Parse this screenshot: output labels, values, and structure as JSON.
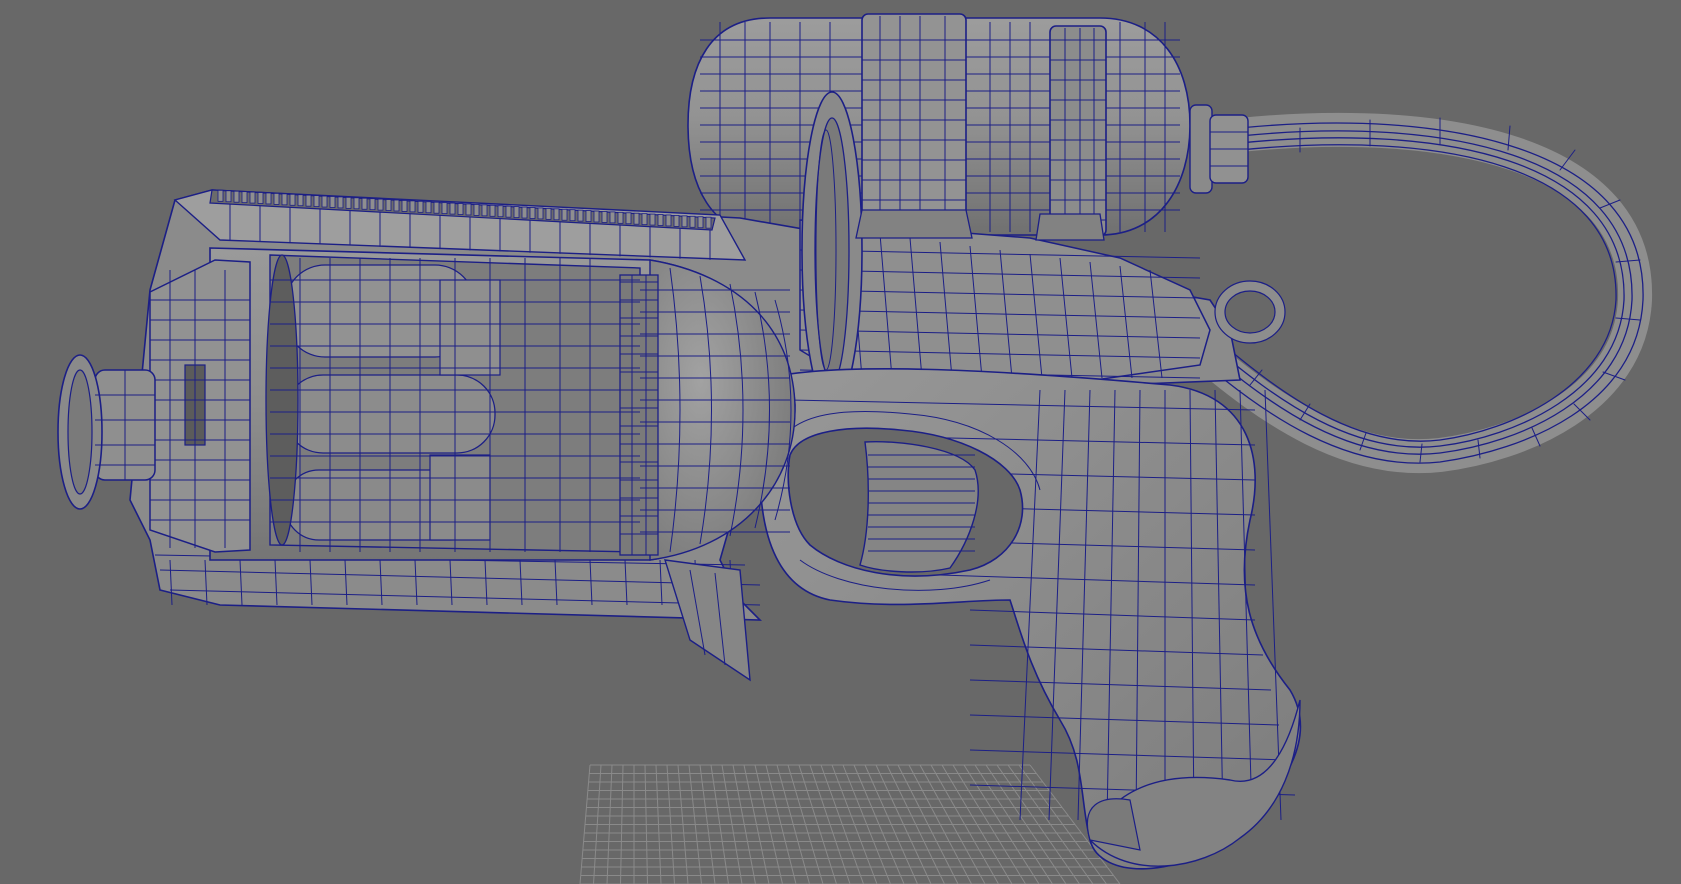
{
  "viewport": {
    "background_color": "#686868",
    "model": {
      "type": "wireframe-on-shaded",
      "surface_color": "#8e8e8e",
      "surface_highlight": "#a4a4a4",
      "surface_shadow": "#6e6e6e",
      "wire_color": "#1c1f86",
      "parts": [
        "barrel-muzzle",
        "frame-top-rail",
        "revolver-cylinder",
        "ring-sight",
        "fuel-tank",
        "tank-nozzle",
        "hose-bundle",
        "grip",
        "trigger-guard",
        "trigger",
        "hammer-sling-loop",
        "underside-fin"
      ]
    },
    "ground_grid": {
      "color": "#8a8a8a",
      "visible": true
    }
  }
}
